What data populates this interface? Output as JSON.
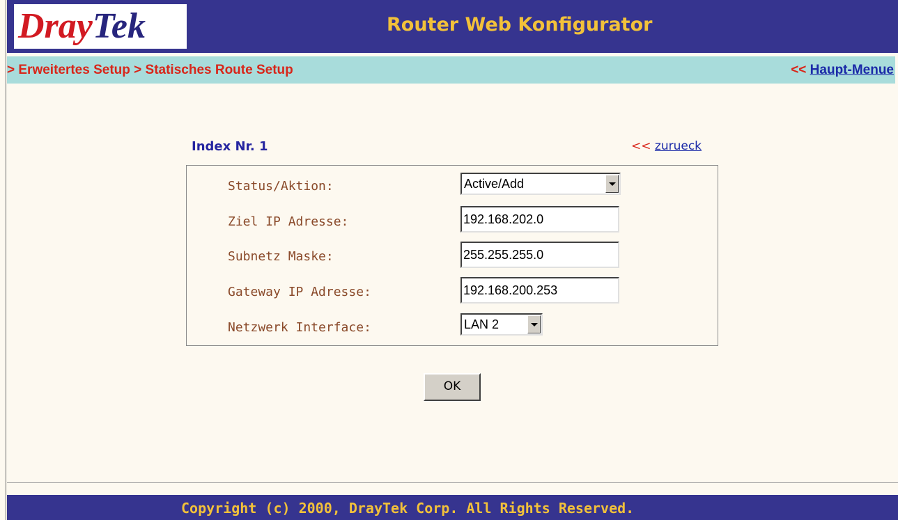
{
  "header": {
    "logo_part1": "Dray",
    "logo_part2": "Tek",
    "title": "Router Web Konfigurator"
  },
  "breadcrumb": {
    "path": "> Erweitertes Setup > Statisches Route Setup",
    "menu_prefix": "<<",
    "menu_link": "Haupt-Menue"
  },
  "form": {
    "index_title": "Index Nr. 1",
    "back_prefix": "<<",
    "back_link": "zurueck",
    "fields": {
      "status": {
        "label": "Status/Aktion:",
        "value": "Active/Add"
      },
      "dest_ip": {
        "label": "Ziel IP Adresse:",
        "value": "192.168.202.0"
      },
      "subnet": {
        "label": "Subnetz Maske:",
        "value": "255.255.255.0"
      },
      "gateway": {
        "label": "Gateway IP Adresse:",
        "value": "192.168.200.253"
      },
      "interface": {
        "label": "Netzwerk Interface:",
        "value": "LAN 2"
      }
    },
    "ok_label": "OK"
  },
  "footer": {
    "copyright": "Copyright (c) 2000, DrayTek Corp. All Rights Reserved."
  },
  "colors": {
    "header_bg": "#36348f",
    "header_text": "#f2c13a",
    "breadcrumb_bg": "#a8dcdb",
    "breadcrumb_text": "#d8261a",
    "link": "#1b2aa8",
    "label": "#8a4a2a",
    "page_bg": "#fdf9f0"
  }
}
